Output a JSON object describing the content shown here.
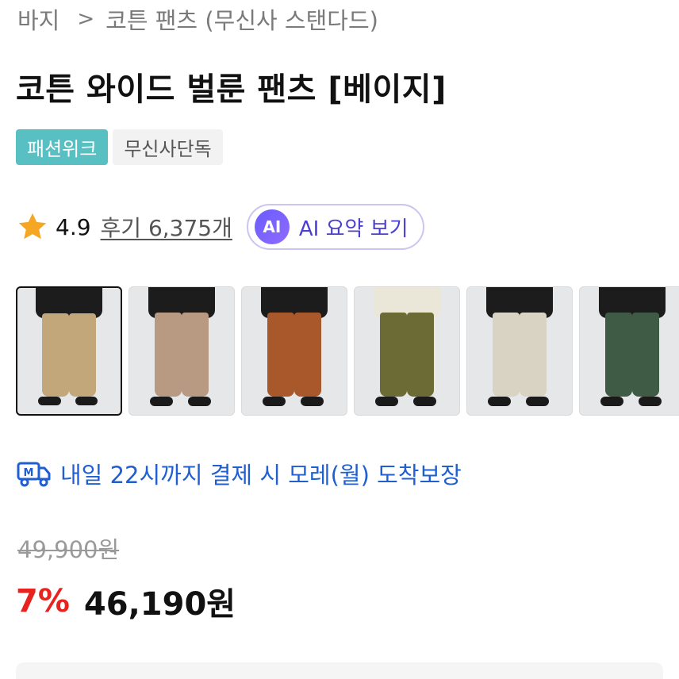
{
  "breadcrumb": {
    "category": "바지",
    "separator": ">",
    "brand_path": "코튼 팬츠 (무신사 스탠다드)"
  },
  "product": {
    "title": "코튼 와이드 벌룬 팬츠 [베이지]"
  },
  "badges": [
    {
      "label": "패션위크",
      "color": "#58bfc2"
    },
    {
      "label": "무신사단독",
      "color": "#f2f2f2"
    }
  ],
  "rating": {
    "icon": "star-icon",
    "value": "4.9",
    "reviews_label": "후기 6,375개"
  },
  "ai_summary": {
    "icon_text": "AI",
    "label": "AI 요약 보기"
  },
  "thumbnails": [
    {
      "color_name": "beige",
      "pants_color": "#c2a77a",
      "top_color": "#1c1c1c",
      "active": true
    },
    {
      "color_name": "brown-beige",
      "pants_color": "#b89a82",
      "top_color": "#1c1c1c",
      "active": false
    },
    {
      "color_name": "brown",
      "pants_color": "#a9582c",
      "top_color": "#1c1c1c",
      "active": false
    },
    {
      "color_name": "khaki",
      "pants_color": "#6c6b35",
      "top_color": "#eae6d8",
      "active": false
    },
    {
      "color_name": "ecru",
      "pants_color": "#d9d3c4",
      "top_color": "#1c1c1c",
      "active": false
    },
    {
      "color_name": "green",
      "pants_color": "#3f5a45",
      "top_color": "#1c1c1c",
      "active": false
    }
  ],
  "delivery": {
    "icon": "delivery-truck-icon",
    "text": "내일 22시까지 결제 시 모레(월) 도착보장",
    "color": "#1f5fd1"
  },
  "price": {
    "original": "49,900원",
    "discount": "7%",
    "sale": "46,190원",
    "discount_color": "#e8231f"
  }
}
